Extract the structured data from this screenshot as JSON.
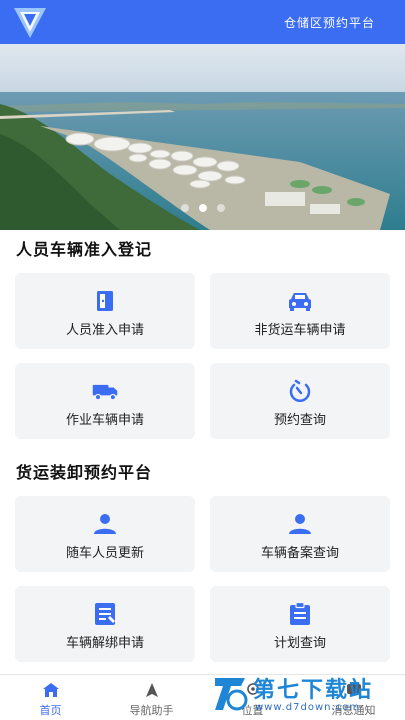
{
  "header": {
    "title": "仓储区预约平台"
  },
  "section1": {
    "title": "人员车辆准入登记",
    "items": [
      {
        "label": "人员准入申请",
        "icon": "door-icon"
      },
      {
        "label": "非货运车辆申请",
        "icon": "car-icon"
      },
      {
        "label": "作业车辆申请",
        "icon": "truck-icon"
      },
      {
        "label": "预约查询",
        "icon": "timer-icon"
      }
    ]
  },
  "section2": {
    "title": "货运装卸预约平台",
    "items": [
      {
        "label": "随车人员更新",
        "icon": "person-icon"
      },
      {
        "label": "车辆备案查询",
        "icon": "person-icon"
      },
      {
        "label": "车辆解绑申请",
        "icon": "form-icon"
      },
      {
        "label": "计划查询",
        "icon": "clipboard-icon"
      }
    ]
  },
  "tabbar": {
    "items": [
      {
        "label": "首页",
        "icon": "home-icon",
        "active": true
      },
      {
        "label": "导航助手",
        "icon": "navigation-icon",
        "active": false
      },
      {
        "label": "位置",
        "icon": "location-icon",
        "active": false
      },
      {
        "label": "消息通知",
        "icon": "message-icon",
        "active": false
      }
    ]
  },
  "watermark": {
    "text": "第七下载站",
    "url": "www.d7down.com"
  },
  "colors": {
    "primary": "#3b6df3",
    "card_bg": "#f3f4f6"
  }
}
